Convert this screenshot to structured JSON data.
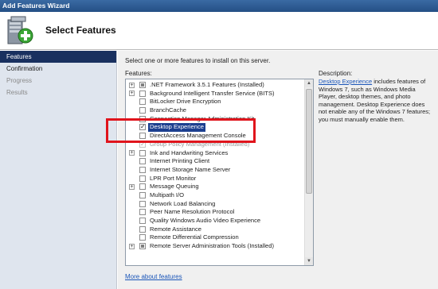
{
  "window": {
    "title": "Add Features Wizard"
  },
  "header": {
    "title": "Select Features",
    "icon": "server-add-icon"
  },
  "nav": {
    "items": [
      {
        "label": "Features",
        "state": "active"
      },
      {
        "label": "Confirmation",
        "state": "normal"
      },
      {
        "label": "Progress",
        "state": "muted"
      },
      {
        "label": "Results",
        "state": "muted"
      }
    ]
  },
  "main": {
    "intro": "Select one or more features to install on this server.",
    "features_label": "Features:",
    "description_label": "Description:",
    "description_link": "Desktop Experience",
    "description_text": " includes features of Windows 7, such as Windows Media Player, desktop themes, and photo management. Desktop Experience does not enable any of the Windows 7 features; you must manually enable them.",
    "more_link": "More about features"
  },
  "features": [
    {
      "label": ".NET Framework 3.5.1 Features  (Installed)",
      "expander": true,
      "check": "partial",
      "grayed": false
    },
    {
      "label": "Background Intelligent Transfer Service (BITS)",
      "expander": true,
      "check": "none",
      "grayed": false
    },
    {
      "label": "BitLocker Drive Encryption",
      "expander": false,
      "check": "none",
      "grayed": false
    },
    {
      "label": "BranchCache",
      "expander": false,
      "check": "none",
      "grayed": false
    },
    {
      "label": "Connection Manager Administration Kit",
      "expander": false,
      "check": "none",
      "grayed": false
    },
    {
      "label": "Desktop Experience",
      "expander": false,
      "check": "checked",
      "grayed": false,
      "selected": true
    },
    {
      "label": "DirectAccess Management Console",
      "expander": false,
      "check": "none",
      "grayed": false
    },
    {
      "label": "Group Policy Management  (Installed)",
      "expander": false,
      "check": "checked",
      "grayed": true
    },
    {
      "label": "Ink and Handwriting Services",
      "expander": true,
      "check": "none",
      "grayed": false
    },
    {
      "label": "Internet Printing Client",
      "expander": false,
      "check": "none",
      "grayed": false
    },
    {
      "label": "Internet Storage Name Server",
      "expander": false,
      "check": "none",
      "grayed": false
    },
    {
      "label": "LPR Port Monitor",
      "expander": false,
      "check": "none",
      "grayed": false
    },
    {
      "label": "Message Queuing",
      "expander": true,
      "check": "none",
      "grayed": false
    },
    {
      "label": "Multipath I/O",
      "expander": false,
      "check": "none",
      "grayed": false
    },
    {
      "label": "Network Load Balancing",
      "expander": false,
      "check": "none",
      "grayed": false
    },
    {
      "label": "Peer Name Resolution Protocol",
      "expander": false,
      "check": "none",
      "grayed": false
    },
    {
      "label": "Quality Windows Audio Video Experience",
      "expander": false,
      "check": "none",
      "grayed": false
    },
    {
      "label": "Remote Assistance",
      "expander": false,
      "check": "none",
      "grayed": false
    },
    {
      "label": "Remote Differential Compression",
      "expander": false,
      "check": "none",
      "grayed": false
    },
    {
      "label": "Remote Server Administration Tools  (Installed)",
      "expander": true,
      "check": "partial",
      "grayed": false
    }
  ],
  "colors": {
    "titlebar": "#244f85",
    "nav_active": "#19305f",
    "selection": "#1c3f8f",
    "link": "#1a55b8",
    "highlight_box": "#e0141c"
  }
}
